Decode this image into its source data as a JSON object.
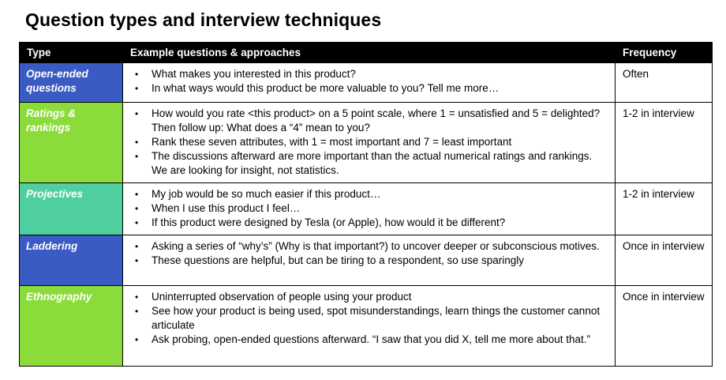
{
  "title": "Question types and interview techniques",
  "table": {
    "headers": {
      "type": "Type",
      "examples": "Example questions & approaches",
      "frequency": "Frequency"
    },
    "rows": [
      {
        "type": "Open-ended questions",
        "color": "#3b5bc4",
        "bullets": [
          "What makes you interested in this product?",
          "In what ways would this product be more valuable to you? Tell me more…"
        ],
        "frequency": "Often"
      },
      {
        "type": "Ratings & rankings",
        "color": "#8bdc3a",
        "bullets": [
          "How would you rate <this product> on a 5 point scale, where 1 = unsatisfied and 5 = delighted? Then follow up: What does a “4” mean to you?",
          "Rank these seven attributes, with 1 = most important and 7 = least important",
          "The discussions afterward are more important than the actual numerical ratings and rankings. We are looking for insight, not statistics."
        ],
        "frequency": "1-2 in interview"
      },
      {
        "type": "Projectives",
        "color": "#4fcf9f",
        "bullets": [
          "My job would be so much easier if this product…",
          "When I use this product I feel…",
          "If this product were designed by Tesla (or Apple), how would it be different?"
        ],
        "frequency": "1-2 in interview"
      },
      {
        "type": "Laddering",
        "color": "#3b5bc4",
        "bullets": [
          "Asking a series of “why’s” (Why is that important?) to uncover deeper or subconscious motives.",
          "These questions are helpful, but can be tiring to a respondent, so use sparingly"
        ],
        "frequency": "Once in interview"
      },
      {
        "type": "Ethnography",
        "color": "#8bdc3a",
        "bullets": [
          "Uninterrupted observation of people using your product",
          "See how your product is being used, spot misunderstandings, learn things the customer cannot articulate",
          "Ask probing, open-ended questions afterward. “I saw that you did X, tell me more about that.”"
        ],
        "frequency": "Once in interview"
      }
    ]
  }
}
